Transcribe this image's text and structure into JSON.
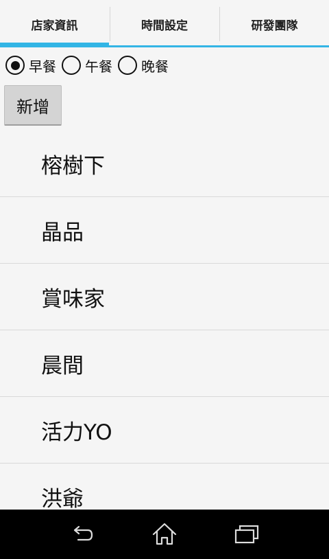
{
  "tabs": [
    {
      "label": "店家資訊",
      "selected": true
    },
    {
      "label": "時間設定",
      "selected": false
    },
    {
      "label": "研發團隊",
      "selected": false
    }
  ],
  "meal_options": [
    {
      "label": "早餐",
      "checked": true
    },
    {
      "label": "午餐",
      "checked": false
    },
    {
      "label": "晚餐",
      "checked": false
    }
  ],
  "add_button": {
    "label": "新增"
  },
  "stores": [
    "榕樹下",
    "晶品",
    "賞味家",
    "晨間",
    "活力YO",
    "洪爺"
  ],
  "colors": {
    "accent": "#33b5e5",
    "background": "#f5f5f5",
    "navbar": "#000000",
    "button": "#d4d4d4"
  },
  "navbar_icons": [
    "back-icon",
    "home-icon",
    "recent-apps-icon"
  ]
}
